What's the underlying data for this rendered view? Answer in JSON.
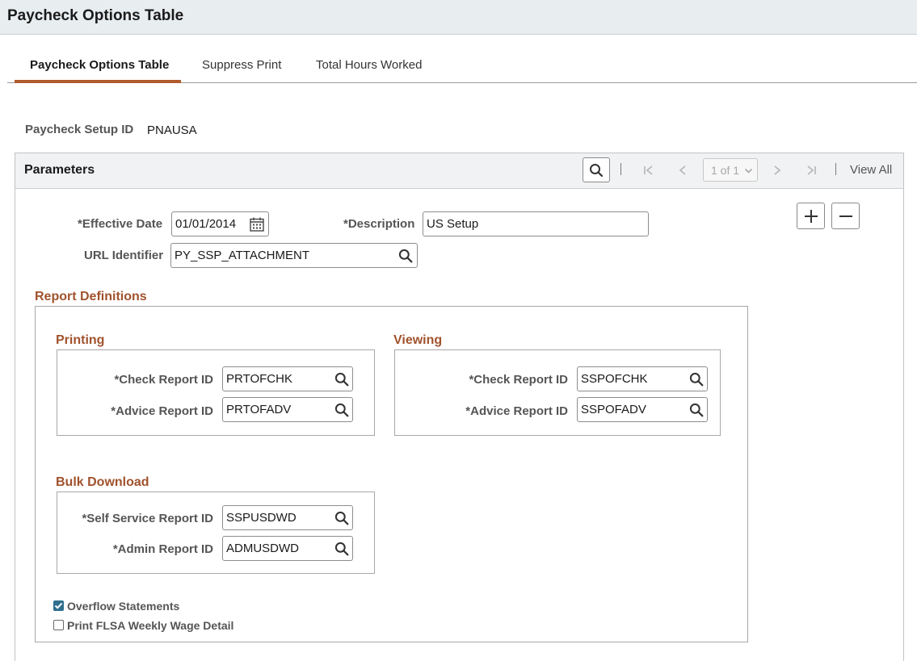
{
  "page": {
    "title": "Paycheck Options Table"
  },
  "tabs": [
    {
      "label": "Paycheck Options Table",
      "active": true
    },
    {
      "label": "Suppress Print",
      "active": false
    },
    {
      "label": "Total Hours Worked",
      "active": false
    }
  ],
  "setup": {
    "label": "Paycheck Setup ID",
    "value": "PNAUSA"
  },
  "parameters": {
    "title": "Parameters",
    "pager": {
      "range": "1 of 1",
      "view_all": "View All"
    },
    "effective_date": {
      "label": "*Effective Date",
      "value": "01/01/2014"
    },
    "description": {
      "label": "*Description",
      "value": "US Setup"
    },
    "url_identifier": {
      "label": "URL Identifier",
      "value": "PY_SSP_ATTACHMENT"
    },
    "report_definitions": {
      "title": "Report Definitions",
      "printing": {
        "title": "Printing",
        "check": {
          "label": "*Check Report ID",
          "value": "PRTOFCHK"
        },
        "advice": {
          "label": "*Advice Report ID",
          "value": "PRTOFADV"
        }
      },
      "viewing": {
        "title": "Viewing",
        "check": {
          "label": "*Check Report ID",
          "value": "SSPOFCHK"
        },
        "advice": {
          "label": "*Advice Report ID",
          "value": "SSPOFADV"
        }
      },
      "bulk_download": {
        "title": "Bulk Download",
        "self_service": {
          "label": "*Self Service Report ID",
          "value": "SSPUSDWD"
        },
        "admin": {
          "label": "*Admin Report ID",
          "value": "ADMUSDWD"
        }
      },
      "overflow": {
        "label": "Overflow Statements",
        "checked": true
      },
      "flsa": {
        "label": "Print FLSA Weekly Wage Detail",
        "checked": false
      }
    }
  },
  "colors": {
    "accent": "#a0522d",
    "tab_underline": "#b25a2c",
    "header_bg": "#e8eef0",
    "checkbox": "#2f6f8f"
  },
  "icons": [
    "search-icon",
    "first-page-icon",
    "previous-icon",
    "chevron-down-icon",
    "next-icon",
    "last-page-icon",
    "calendar-icon",
    "lookup-icon",
    "add-icon",
    "delete-icon",
    "check-icon"
  ]
}
